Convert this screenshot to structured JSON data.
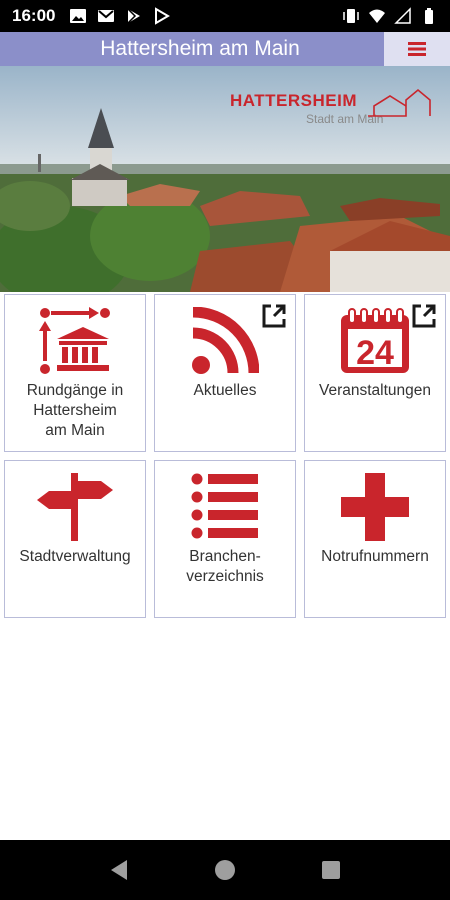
{
  "status_bar": {
    "time": "16:00",
    "left_icons": [
      "image-icon",
      "gmail-icon",
      "play-store-icon",
      "play-store-outline-icon"
    ],
    "right_icons": [
      "vibrate-icon",
      "wifi-icon",
      "signal-icon",
      "battery-icon"
    ]
  },
  "header": {
    "title": "Hattersheim am Main",
    "menu_icon": "hamburger-icon"
  },
  "hero": {
    "logo_word": "HATTERSHEIM",
    "logo_sub": "Stadt am Main"
  },
  "tiles": [
    {
      "label": "Rundgänge in\nHattersheim\nam Main",
      "icon": "tour-museum-icon",
      "external": false
    },
    {
      "label": "Aktuelles",
      "icon": "rss-icon",
      "external": true
    },
    {
      "label": "Veranstaltungen",
      "icon": "calendar-24-icon",
      "external": true
    },
    {
      "label": "Stadtverwaltung",
      "icon": "signpost-icon",
      "external": false
    },
    {
      "label": "Branchen-\nverzeichnis",
      "icon": "list-icon",
      "external": false
    },
    {
      "label": "Notrufnummern",
      "icon": "cross-icon",
      "external": false
    }
  ],
  "calendar_number": "24",
  "colors": {
    "accent_red": "#c9252c",
    "header_blue": "#8b8fc9",
    "menu_bg": "#dfe0f1"
  }
}
